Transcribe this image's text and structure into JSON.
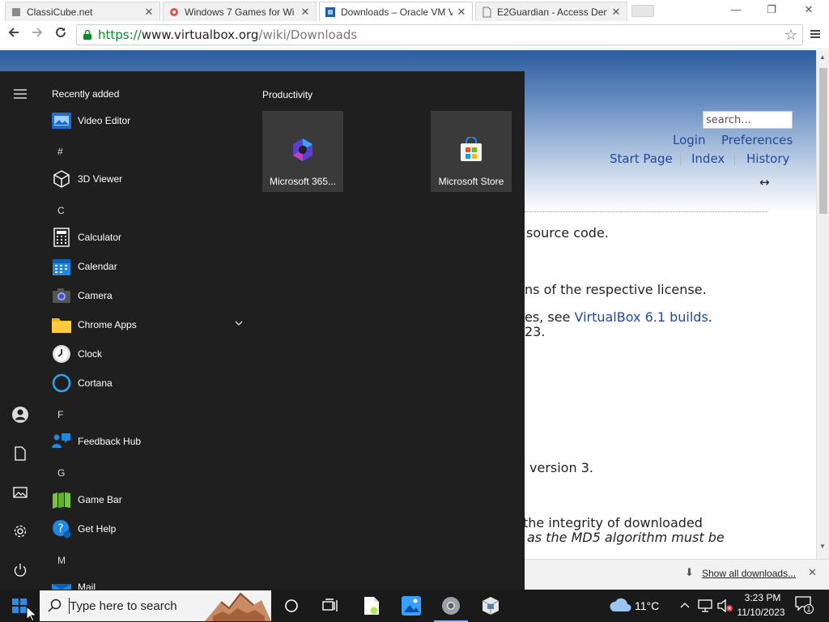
{
  "browser": {
    "tabs": [
      {
        "title": "ClassiCube.net"
      },
      {
        "title": "Windows 7 Games for Wi"
      },
      {
        "title": "Downloads – Oracle VM V"
      },
      {
        "title": "E2Guardian - Access Deni"
      }
    ],
    "url": {
      "scheme": "https://",
      "host": "www.virtualbox.org",
      "path": "/wiki/Downloads"
    }
  },
  "webpage": {
    "search_placeholder": "search...",
    "links": {
      "login": "Login",
      "preferences": "Preferences",
      "start_page": "Start Page",
      "index": "Index",
      "history": "History"
    },
    "resize_glyph": "↔",
    "lines": {
      "source_code": "source code.",
      "license": "ns of the respective license.",
      "builds_prefix": "es, see ",
      "builds_link": "VirtualBox 6.1 builds",
      "builds_suffix": ".",
      "year": "23.",
      "version3": "version 3.",
      "integrity": "the integrity of downloaded",
      "md5": "as the MD5 algorithm must be"
    }
  },
  "downloads_bar": {
    "show_all": "Show all downloads..."
  },
  "start_menu": {
    "section_title": "Recently added",
    "tiles_title": "Productivity",
    "apps": [
      {
        "type": "app",
        "label": "Video Editor",
        "icon": "video-editor-icon"
      },
      {
        "type": "letter",
        "label": "#"
      },
      {
        "type": "app",
        "label": "3D Viewer",
        "icon": "cube-icon"
      },
      {
        "type": "letter",
        "label": "C"
      },
      {
        "type": "app",
        "label": "Calculator",
        "icon": "calculator-icon"
      },
      {
        "type": "app",
        "label": "Calendar",
        "icon": "calendar-icon"
      },
      {
        "type": "app",
        "label": "Camera",
        "icon": "camera-icon"
      },
      {
        "type": "app",
        "label": "Chrome Apps",
        "icon": "folder-icon"
      },
      {
        "type": "app",
        "label": "Clock",
        "icon": "clock-icon"
      },
      {
        "type": "app",
        "label": "Cortana",
        "icon": "cortana-icon"
      },
      {
        "type": "letter",
        "label": "F"
      },
      {
        "type": "app",
        "label": "Feedback Hub",
        "icon": "feedback-icon"
      },
      {
        "type": "letter",
        "label": "G"
      },
      {
        "type": "app",
        "label": "Game Bar",
        "icon": "gamebar-icon"
      },
      {
        "type": "app",
        "label": "Get Help",
        "icon": "help-icon"
      },
      {
        "type": "letter",
        "label": "M"
      },
      {
        "type": "app",
        "label": "Mail",
        "icon": "mail-icon"
      }
    ],
    "tiles": [
      {
        "label": "Microsoft 365...",
        "icon": "microsoft-365-icon"
      },
      {
        "label": "Microsoft Store",
        "icon": "store-icon"
      }
    ]
  },
  "taskbar": {
    "search_placeholder": "Type here to search",
    "weather_temp": "11°C",
    "time": "3:23 PM",
    "date": "11/10/2023",
    "notification_count": "1"
  }
}
